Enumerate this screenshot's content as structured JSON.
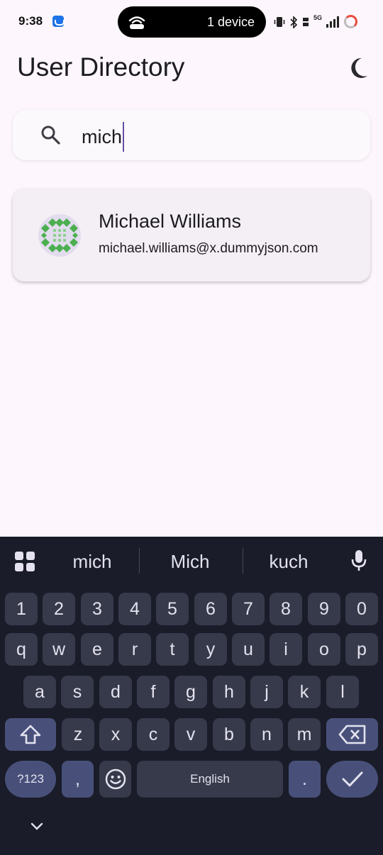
{
  "status_bar": {
    "time": "9:38",
    "island_text": "1 device",
    "network": "5G"
  },
  "app_bar": {
    "title": "User Directory",
    "theme_icon": "moon-icon"
  },
  "search": {
    "value": "mich",
    "icon": "search-icon"
  },
  "results": [
    {
      "name": "Michael Williams",
      "email": "michael.williams@x.dummyjson.com"
    }
  ],
  "keyboard": {
    "suggestions": [
      "mich",
      "Mich",
      "kuch"
    ],
    "number_row": [
      "1",
      "2",
      "3",
      "4",
      "5",
      "6",
      "7",
      "8",
      "9",
      "0"
    ],
    "row1": [
      "q",
      "w",
      "e",
      "r",
      "t",
      "y",
      "u",
      "i",
      "o",
      "p"
    ],
    "row2": [
      "a",
      "s",
      "d",
      "f",
      "g",
      "h",
      "j",
      "k",
      "l"
    ],
    "row3": [
      "z",
      "x",
      "c",
      "v",
      "b",
      "n",
      "m"
    ],
    "symbols_key": "?123",
    "comma_key": ",",
    "space_label": "English",
    "period_key": ".",
    "colors": {
      "background": "#1a1c29",
      "key": "#373a4b",
      "special_key": "#48507a",
      "text": "#e3e2ee"
    }
  },
  "colors": {
    "page_background": "#fdf6fc",
    "accent": "#6750a4",
    "card_background": "#f4eff4"
  }
}
